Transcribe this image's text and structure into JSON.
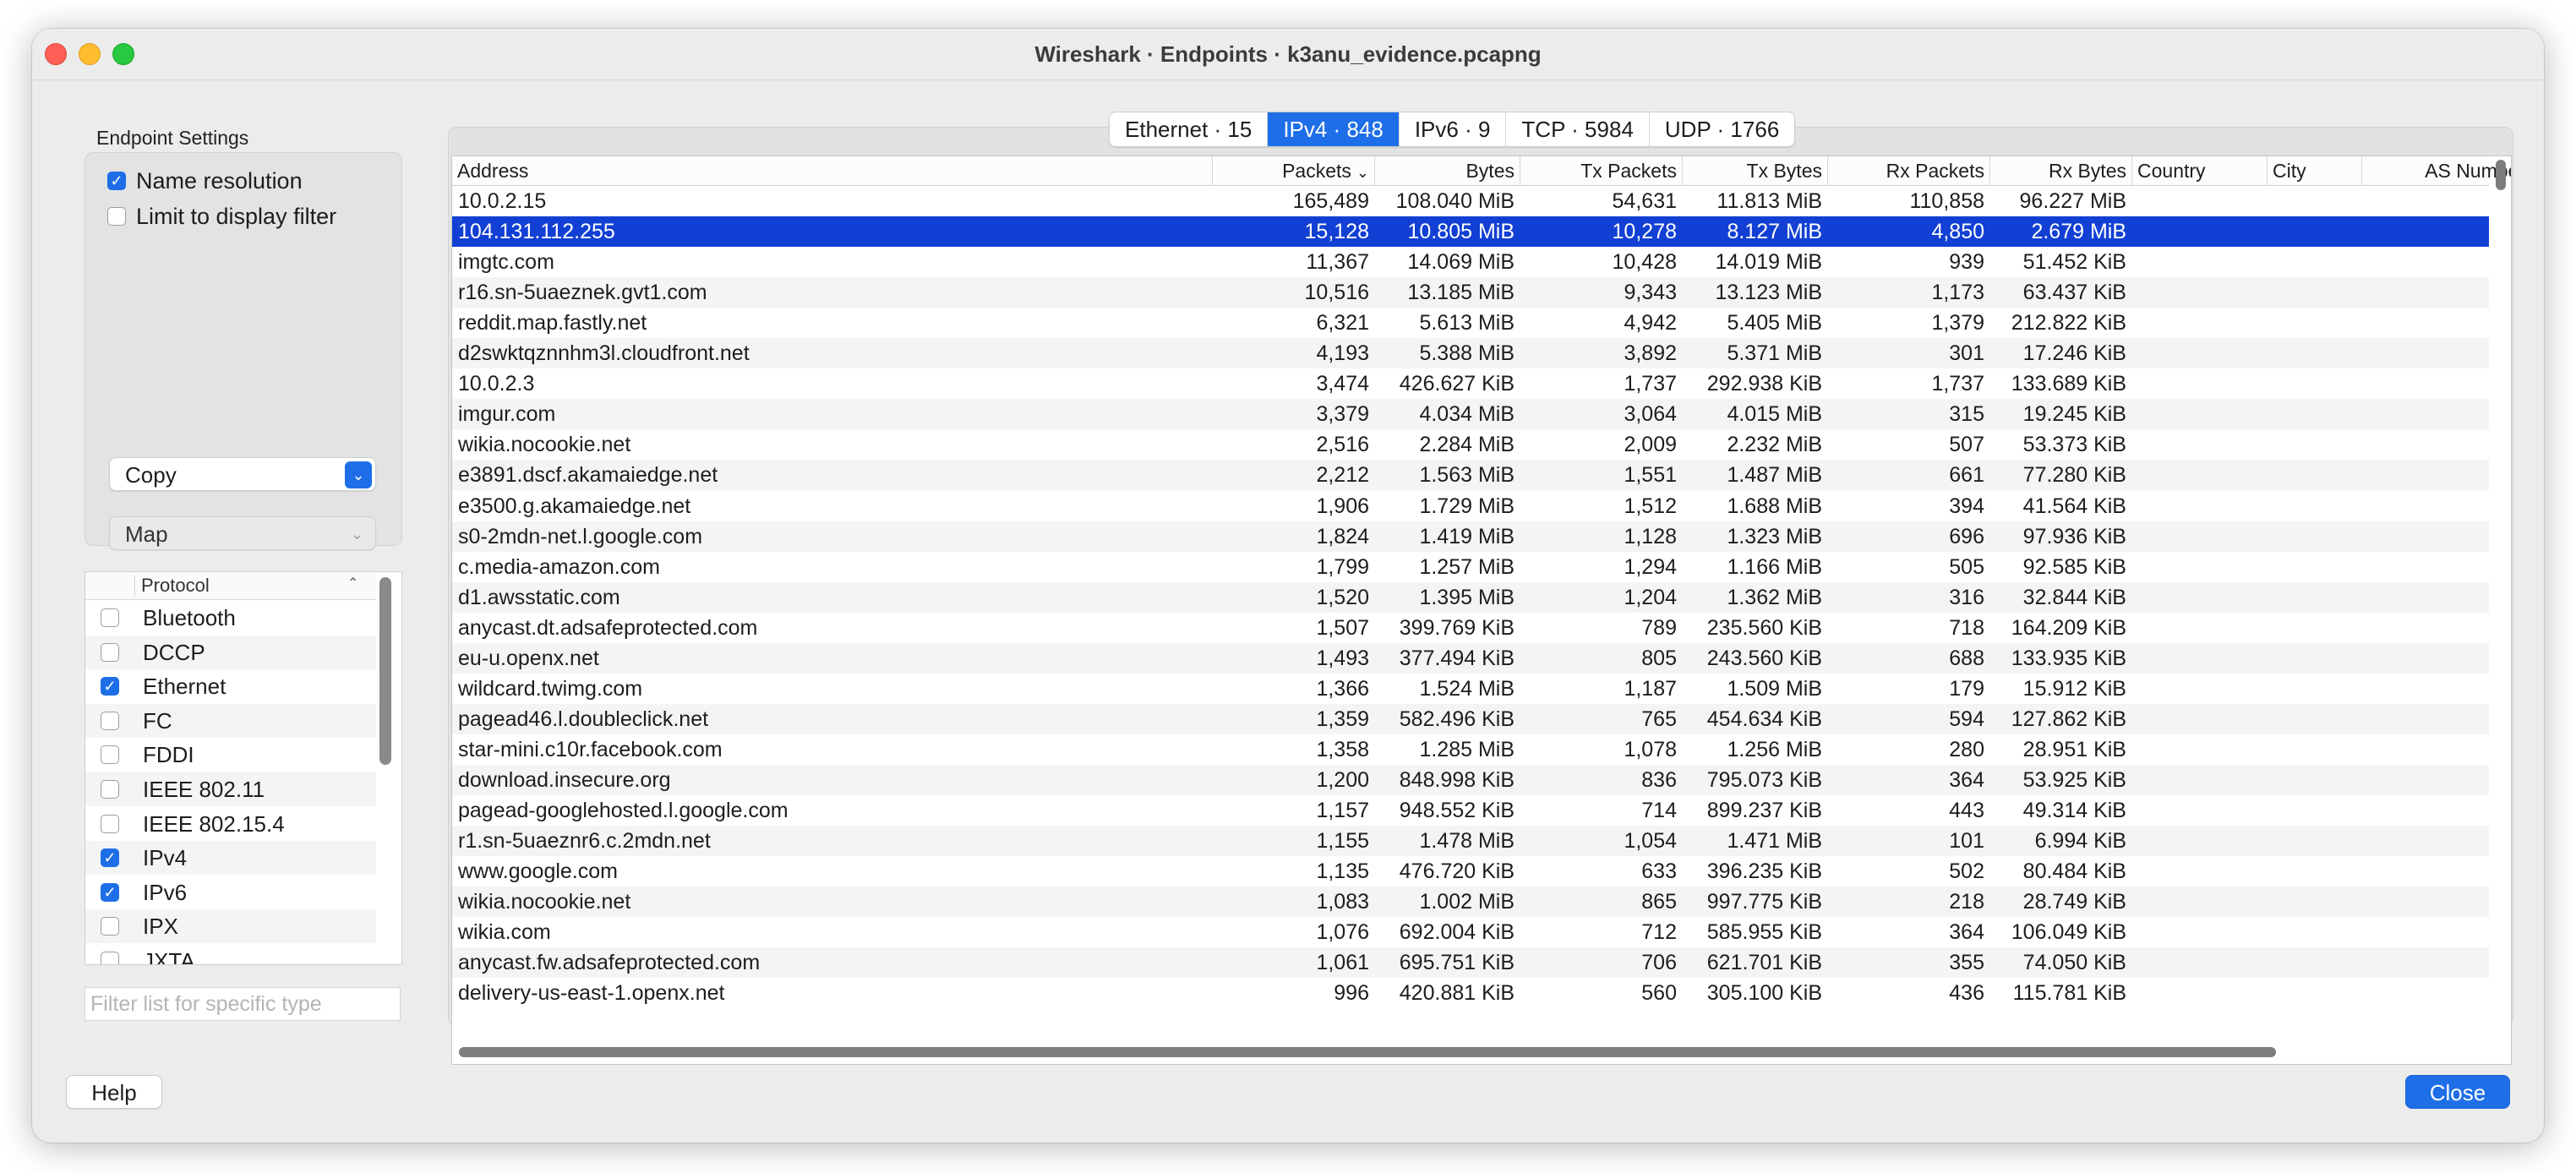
{
  "window": {
    "title": "Wireshark · Endpoints · k3anu_evidence.pcapng"
  },
  "settings": {
    "label": "Endpoint Settings",
    "name_resolution": {
      "label": "Name resolution",
      "checked": true
    },
    "limit_filter": {
      "label": "Limit to display filter",
      "checked": false
    },
    "copy_label": "Copy",
    "map_label": "Map"
  },
  "protocols": {
    "header": "Protocol",
    "items": [
      {
        "label": "Bluetooth",
        "checked": false
      },
      {
        "label": "DCCP",
        "checked": false
      },
      {
        "label": "Ethernet",
        "checked": true
      },
      {
        "label": "FC",
        "checked": false
      },
      {
        "label": "FDDI",
        "checked": false
      },
      {
        "label": "IEEE 802.11",
        "checked": false
      },
      {
        "label": "IEEE 802.15.4",
        "checked": false
      },
      {
        "label": "IPv4",
        "checked": true
      },
      {
        "label": "IPv6",
        "checked": true
      },
      {
        "label": "IPX",
        "checked": false
      },
      {
        "label": "JXTA",
        "checked": false
      }
    ],
    "filter_placeholder": "Filter list for specific type"
  },
  "tabs": [
    "Ethernet · 15",
    "IPv4 · 848",
    "IPv6 · 9",
    "TCP · 5984",
    "UDP · 1766"
  ],
  "active_tab": 1,
  "table": {
    "columns": [
      "Address",
      "Packets",
      "Bytes",
      "Tx Packets",
      "Tx Bytes",
      "Rx Packets",
      "Rx Bytes",
      "Country",
      "City",
      "AS Number"
    ],
    "sort_indicator": "⌄",
    "selected_row": 1,
    "rows": [
      [
        "10.0.2.15",
        "165,489",
        "108.040 MiB",
        "54,631",
        "11.813 MiB",
        "110,858",
        "96.227 MiB"
      ],
      [
        "104.131.112.255",
        "15,128",
        "10.805 MiB",
        "10,278",
        "8.127 MiB",
        "4,850",
        "2.679 MiB"
      ],
      [
        "imgtc.com",
        "11,367",
        "14.069 MiB",
        "10,428",
        "14.019 MiB",
        "939",
        "51.452 KiB"
      ],
      [
        "r16.sn-5uaeznek.gvt1.com",
        "10,516",
        "13.185 MiB",
        "9,343",
        "13.123 MiB",
        "1,173",
        "63.437 KiB"
      ],
      [
        "reddit.map.fastly.net",
        "6,321",
        "5.613 MiB",
        "4,942",
        "5.405 MiB",
        "1,379",
        "212.822 KiB"
      ],
      [
        "d2swktqznnhm3l.cloudfront.net",
        "4,193",
        "5.388 MiB",
        "3,892",
        "5.371 MiB",
        "301",
        "17.246 KiB"
      ],
      [
        "10.0.2.3",
        "3,474",
        "426.627 KiB",
        "1,737",
        "292.938 KiB",
        "1,737",
        "133.689 KiB"
      ],
      [
        "imgur.com",
        "3,379",
        "4.034 MiB",
        "3,064",
        "4.015 MiB",
        "315",
        "19.245 KiB"
      ],
      [
        "wikia.nocookie.net",
        "2,516",
        "2.284 MiB",
        "2,009",
        "2.232 MiB",
        "507",
        "53.373 KiB"
      ],
      [
        "e3891.dscf.akamaiedge.net",
        "2,212",
        "1.563 MiB",
        "1,551",
        "1.487 MiB",
        "661",
        "77.280 KiB"
      ],
      [
        "e3500.g.akamaiedge.net",
        "1,906",
        "1.729 MiB",
        "1,512",
        "1.688 MiB",
        "394",
        "41.564 KiB"
      ],
      [
        "s0-2mdn-net.l.google.com",
        "1,824",
        "1.419 MiB",
        "1,128",
        "1.323 MiB",
        "696",
        "97.936 KiB"
      ],
      [
        "c.media-amazon.com",
        "1,799",
        "1.257 MiB",
        "1,294",
        "1.166 MiB",
        "505",
        "92.585 KiB"
      ],
      [
        "d1.awsstatic.com",
        "1,520",
        "1.395 MiB",
        "1,204",
        "1.362 MiB",
        "316",
        "32.844 KiB"
      ],
      [
        "anycast.dt.adsafeprotected.com",
        "1,507",
        "399.769 KiB",
        "789",
        "235.560 KiB",
        "718",
        "164.209 KiB"
      ],
      [
        "eu-u.openx.net",
        "1,493",
        "377.494 KiB",
        "805",
        "243.560 KiB",
        "688",
        "133.935 KiB"
      ],
      [
        "wildcard.twimg.com",
        "1,366",
        "1.524 MiB",
        "1,187",
        "1.509 MiB",
        "179",
        "15.912 KiB"
      ],
      [
        "pagead46.l.doubleclick.net",
        "1,359",
        "582.496 KiB",
        "765",
        "454.634 KiB",
        "594",
        "127.862 KiB"
      ],
      [
        "star-mini.c10r.facebook.com",
        "1,358",
        "1.285 MiB",
        "1,078",
        "1.256 MiB",
        "280",
        "28.951 KiB"
      ],
      [
        "download.insecure.org",
        "1,200",
        "848.998 KiB",
        "836",
        "795.073 KiB",
        "364",
        "53.925 KiB"
      ],
      [
        "pagead-googlehosted.l.google.com",
        "1,157",
        "948.552 KiB",
        "714",
        "899.237 KiB",
        "443",
        "49.314 KiB"
      ],
      [
        "r1.sn-5uaeznr6.c.2mdn.net",
        "1,155",
        "1.478 MiB",
        "1,054",
        "1.471 MiB",
        "101",
        "6.994 KiB"
      ],
      [
        "www.google.com",
        "1,135",
        "476.720 KiB",
        "633",
        "396.235 KiB",
        "502",
        "80.484 KiB"
      ],
      [
        "wikia.nocookie.net",
        "1,083",
        "1.002 MiB",
        "865",
        "997.775 KiB",
        "218",
        "28.749 KiB"
      ],
      [
        "wikia.com",
        "1,076",
        "692.004 KiB",
        "712",
        "585.955 KiB",
        "364",
        "106.049 KiB"
      ],
      [
        "anycast.fw.adsafeprotected.com",
        "1,061",
        "695.751 KiB",
        "706",
        "621.701 KiB",
        "355",
        "74.050 KiB"
      ],
      [
        "delivery-us-east-1.openx.net",
        "996",
        "420.881 KiB",
        "560",
        "305.100 KiB",
        "436",
        "115.781 KiB"
      ]
    ]
  },
  "buttons": {
    "help": "Help",
    "close": "Close"
  },
  "colors": {
    "accent": "#1e6ee8",
    "selection": "#1240d4"
  }
}
